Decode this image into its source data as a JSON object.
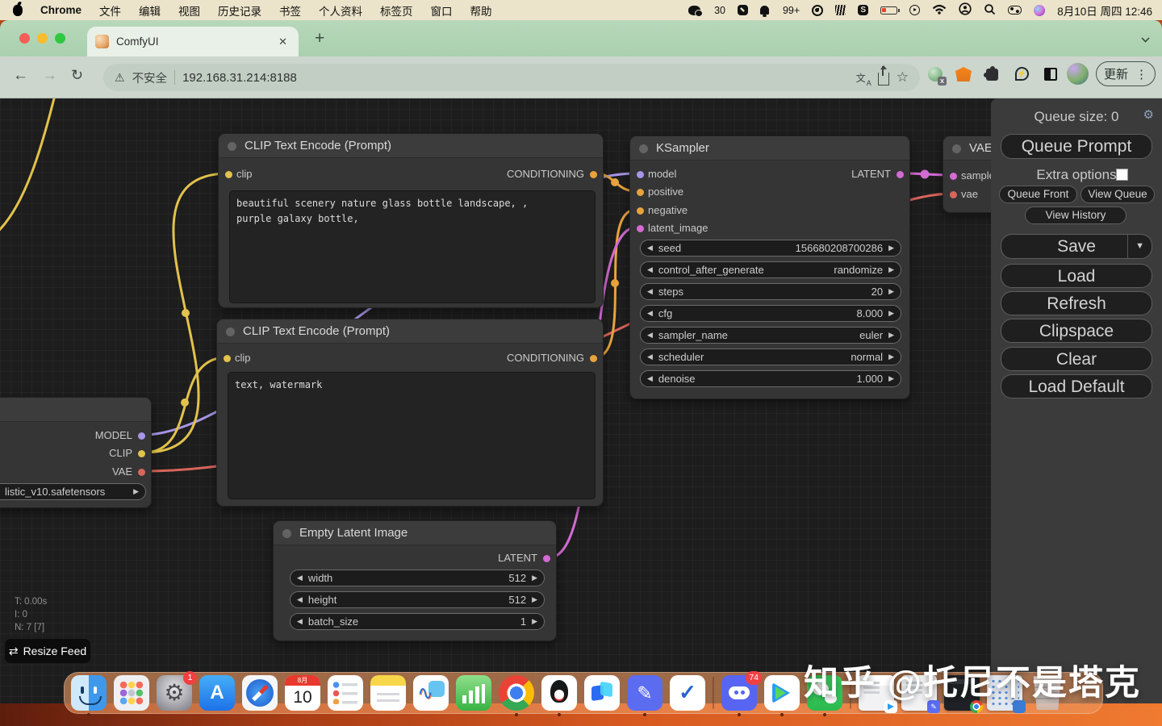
{
  "menu_bar": {
    "app_name": "Chrome",
    "items": [
      "文件",
      "编辑",
      "视图",
      "历史记录",
      "书签",
      "个人资料",
      "标签页",
      "窗口",
      "帮助"
    ],
    "wechat_badge": "30",
    "bell_badge": "99+",
    "clock": "8月10日 周四 12:46"
  },
  "browser": {
    "tab_title": "ComfyUI",
    "security_label": "不安全",
    "url": "192.168.31.214:8188",
    "update_label": "更新"
  },
  "nodes": {
    "clip1": {
      "title": "CLIP Text Encode (Prompt)",
      "input": "clip",
      "output": "CONDITIONING",
      "text": "beautiful scenery nature glass bottle landscape, ,\npurple galaxy bottle,"
    },
    "clip2": {
      "title": "CLIP Text Encode (Prompt)",
      "input": "clip",
      "output": "CONDITIONING",
      "text": "text, watermark"
    },
    "ksampler": {
      "title": "KSampler",
      "inputs": [
        "model",
        "positive",
        "negative",
        "latent_image"
      ],
      "output": "LATENT",
      "widgets": [
        {
          "label": "seed",
          "value": "156680208700286"
        },
        {
          "label": "control_after_generate",
          "value": "randomize"
        },
        {
          "label": "steps",
          "value": "20"
        },
        {
          "label": "cfg",
          "value": "8.000"
        },
        {
          "label": "sampler_name",
          "value": "euler"
        },
        {
          "label": "scheduler",
          "value": "normal"
        },
        {
          "label": "denoise",
          "value": "1.000"
        }
      ]
    },
    "vae_decode": {
      "title": "VAE",
      "inputs": [
        "samples",
        "vae"
      ]
    },
    "checkpoint": {
      "outputs": [
        "MODEL",
        "CLIP",
        "VAE"
      ],
      "widget_value": "listic_v10.safetensors"
    },
    "empty_latent": {
      "title": "Empty Latent Image",
      "output": "LATENT",
      "widgets": [
        {
          "label": "width",
          "value": "512"
        },
        {
          "label": "height",
          "value": "512"
        },
        {
          "label": "batch_size",
          "value": "1"
        }
      ]
    }
  },
  "menu_panel": {
    "queue_size": "Queue size: 0",
    "queue_prompt": "Queue Prompt",
    "extra_options": "Extra options",
    "queue_front": "Queue Front",
    "view_queue": "View Queue",
    "view_history": "View History",
    "save": "Save",
    "load": "Load",
    "refresh": "Refresh",
    "clipspace": "Clipspace",
    "clear": "Clear",
    "load_default": "Load Default"
  },
  "canvas_stats": {
    "t": "T: 0.00s",
    "i": "I: 0",
    "n": "N: 7 [7]",
    "resize_feed": "Resize Feed"
  },
  "dock": {
    "settings_badge": "1",
    "discord_badge": "74",
    "calendar_month": "8月",
    "calendar_day": "10"
  },
  "watermark": "知乎 @托尼不是塔克",
  "icons": {
    "gear": "⚙",
    "star": "☆",
    "back": "←",
    "forward": "→",
    "reload": "↻",
    "warning": "⚠",
    "close": "✕",
    "new_tab": "+",
    "menu_dots": "⋮",
    "save_caret": "▼",
    "arrow_left": "◀",
    "arrow_right": "▶",
    "resize": "⇄",
    "translate": "文",
    "pencil": "✎",
    "check": "✓"
  },
  "colors": {
    "wire_clip": "#E2C24C",
    "wire_conditioning": "#E8A33D",
    "wire_model": "#A695E8",
    "wire_vae": "#D9655C",
    "wire_latent": "#D36BD3"
  }
}
